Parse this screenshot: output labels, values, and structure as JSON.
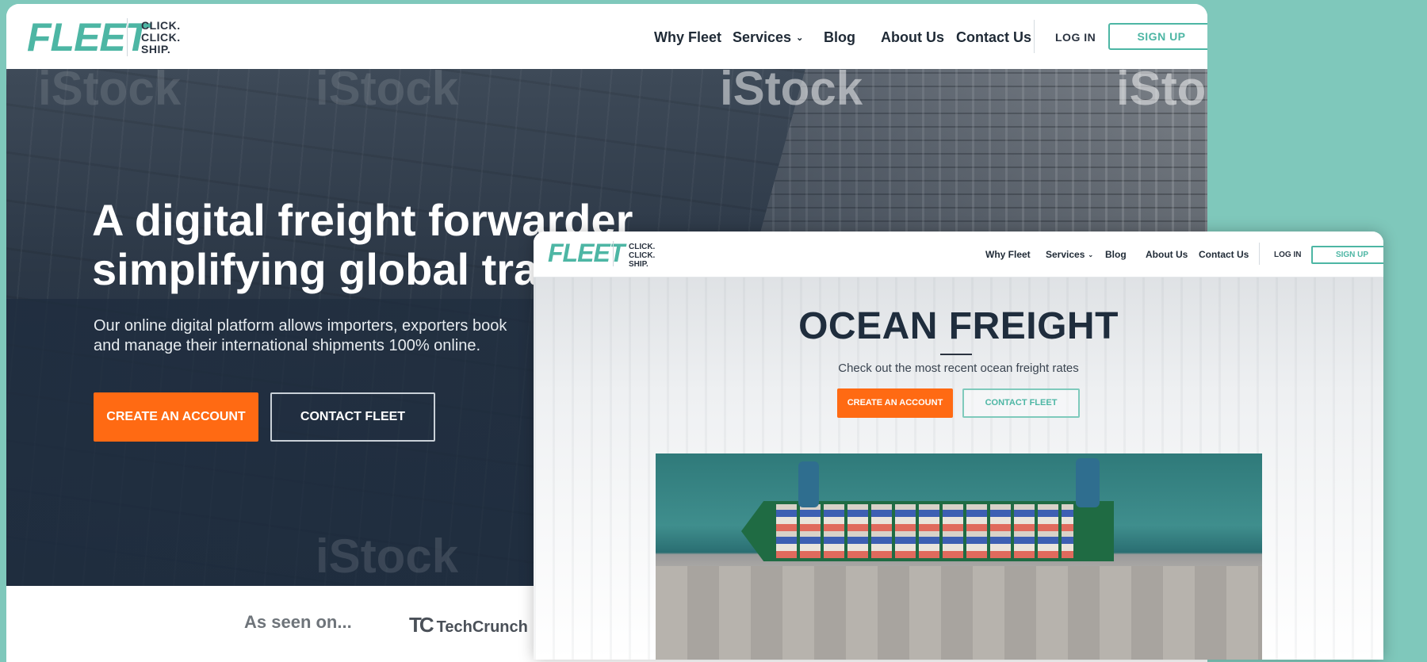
{
  "back_window": {
    "logo": "FLEET",
    "tagline": [
      "CLICK.",
      "CLICK.",
      "SHIP."
    ],
    "nav": [
      "Why Fleet",
      "Services",
      "Blog",
      "About Us",
      "Contact Us"
    ],
    "login": "LOG IN",
    "signup": "SIGN UP",
    "headline": [
      "A digital freight forwarder",
      "simplifying global trac"
    ],
    "subtext": [
      "Our online digital platform allows importers, exporters book",
      "and manage their international shipments 100% online."
    ],
    "create_account": "CREATE AN ACCOUNT",
    "contact_fleet": "CONTACT FLEET",
    "as_seen_on": "As seen on...",
    "press": "TechCrunch",
    "press_mark": "TC",
    "watermark": "iStock"
  },
  "front_window": {
    "logo": "FLEET",
    "tagline": [
      "CLICK.",
      "CLICK.",
      "SHIP."
    ],
    "nav": [
      "Why Fleet",
      "Services",
      "Blog",
      "About Us",
      "Contact Us"
    ],
    "login": "LOG IN",
    "signup": "SIGN UP",
    "title": "OCEAN FREIGHT",
    "subtitle": "Check out the most recent ocean freight rates",
    "create_account": "CREATE AN ACCOUNT",
    "contact_fleet": "CONTACT FLEET"
  },
  "colors": {
    "brand_teal": "#4db6a4",
    "accent_orange": "#ff6a13",
    "navy": "#1f2d3d",
    "page_background": "#7fc8bb"
  },
  "icons": [
    "chevron-down-icon"
  ]
}
